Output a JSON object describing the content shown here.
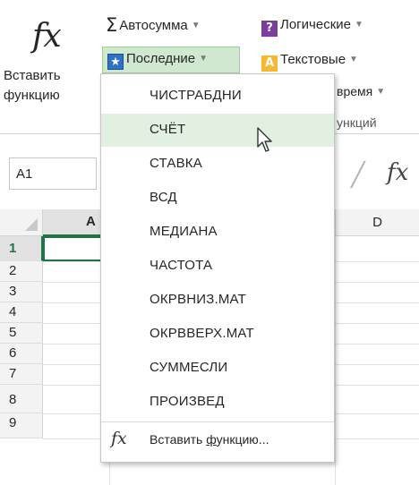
{
  "ribbon": {
    "insert_function_label_line1": "Вставить",
    "insert_function_label_line2": "функцию",
    "fx_symbol": "fx",
    "autosum_label": "Автосумма",
    "logical_label": "Логические",
    "recent_label": "Последние",
    "text_label": "Текстовые",
    "datetime_partial": "время",
    "library_partial": "ункций",
    "logical_icon_glyph": "?",
    "text_icon_glyph": "A",
    "recent_icon_glyph": "★"
  },
  "formula_bar": {
    "name_box_value": "A1",
    "fx_symbol": "fx"
  },
  "grid": {
    "column_a": "A",
    "column_d": "D",
    "rows": [
      "1",
      "2",
      "3",
      "4",
      "5",
      "6",
      "7",
      "8",
      "9"
    ]
  },
  "menu": {
    "items": [
      "ЧИСТРАБДНИ",
      "СЧЁТ",
      "СТАВКА",
      "ВСД",
      "МЕДИАНА",
      "ЧАСТОТА",
      "ОКРВНИЗ.МАТ",
      "ОКРВВЕРХ.МАТ",
      "СУММЕСЛИ",
      "ПРОИЗВЕД"
    ],
    "hovered_index": 1,
    "insert_function_prefix": "Вставить ",
    "insert_function_underlined": "ф",
    "insert_function_rest": "ункцию...",
    "fx_symbol": "fx"
  },
  "colors": {
    "excel_green": "#217346",
    "hover_green": "#e2f0e2",
    "recent_button_bg": "#cfe8cf"
  }
}
